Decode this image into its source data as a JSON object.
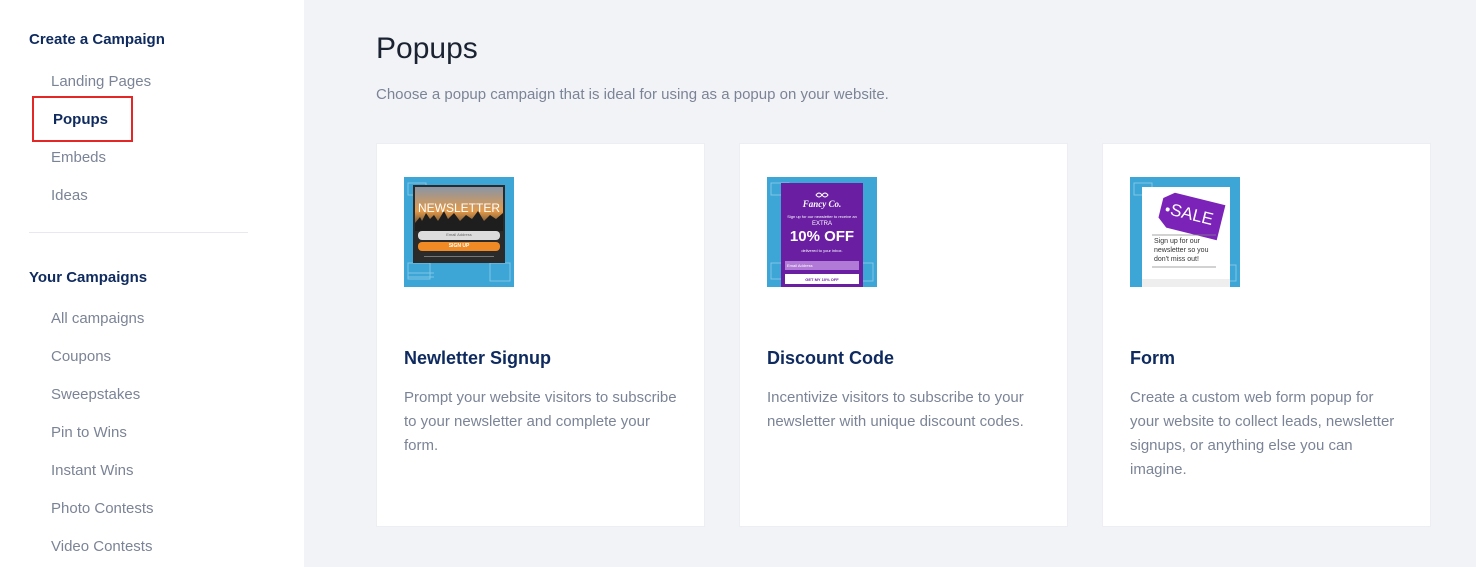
{
  "sidebar": {
    "create_title": "Create a Campaign",
    "create_items": [
      {
        "label": "Landing Pages"
      },
      {
        "label": "Popups",
        "active": true
      },
      {
        "label": "Embeds"
      },
      {
        "label": "Ideas"
      }
    ],
    "your_title": "Your Campaigns",
    "your_items": [
      {
        "label": "All campaigns"
      },
      {
        "label": "Coupons"
      },
      {
        "label": "Sweepstakes"
      },
      {
        "label": "Pin to Wins"
      },
      {
        "label": "Instant Wins"
      },
      {
        "label": "Photo Contests"
      },
      {
        "label": "Video Contests"
      }
    ]
  },
  "main": {
    "title": "Popups",
    "subtitle": "Choose a popup campaign that is ideal for using as a popup on your website.",
    "cards": [
      {
        "title": "Newletter Signup",
        "description": "Prompt your website visitors to subscribe to your newsletter and complete your form.",
        "thumb": {
          "headline": "NEWSLETTER",
          "field": "Email Address",
          "button": "SIGN UP"
        }
      },
      {
        "title": "Discount Code",
        "description": "Incentivize visitors to subscribe to your newsletter with unique discount codes.",
        "thumb": {
          "brand": "Fancy Co.",
          "line1": "Sign up for our newsletter to receive an",
          "line2": "EXTRA",
          "offer": "10% OFF",
          "line3": "delivered to your inbox.",
          "field": "Email Address",
          "button": "GET MY 10% OFF"
        }
      },
      {
        "title": "Form",
        "description": "Create a custom web form popup for your website to collect leads, newsletter signups, or anything else you can imagine.",
        "thumb": {
          "tag": "SALE",
          "text": "Sign up for our newsletter so you don't miss out!"
        }
      }
    ]
  },
  "colors": {
    "accent": "#0e2a5e",
    "muted": "#7b8496",
    "highlight": "#e32626",
    "thumb_blue": "#3ea6d6",
    "purple": "#6a1fa3",
    "orange": "#f08a24"
  }
}
